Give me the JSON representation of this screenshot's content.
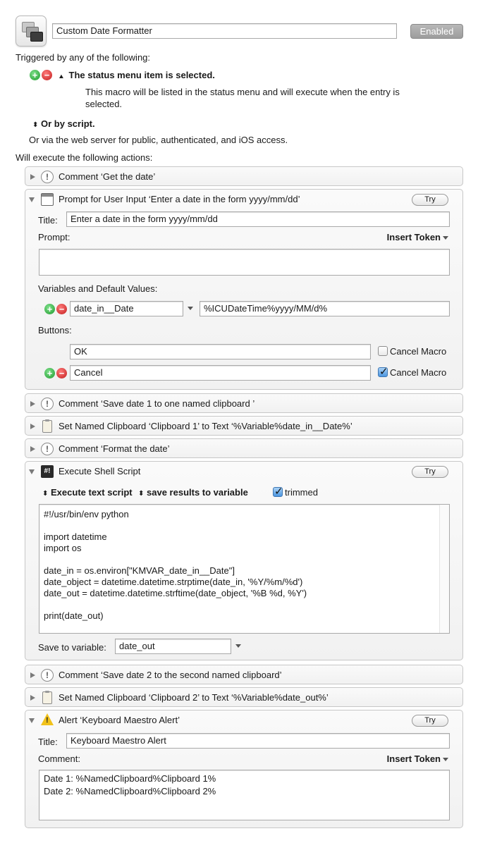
{
  "macro": {
    "name": "Custom Date Formatter",
    "enabled_label": "Enabled"
  },
  "triggers": {
    "heading": "Triggered by any of the following:",
    "status_menu_title": "The status menu item is selected.",
    "status_menu_desc_1": "This macro will be listed in the status menu and will execute when the entry is",
    "status_menu_desc_2": "selected.",
    "by_script": "Or by script.",
    "web_server": "Or via the web server for public, authenticated, and iOS access."
  },
  "actions_heading": "Will execute the following actions:",
  "common": {
    "try_label": "Try",
    "insert_token_label": "Insert Token",
    "title_label": "Title:"
  },
  "actions": {
    "comment_get_date": {
      "title": "Comment ‘Get the date’"
    },
    "prompt": {
      "title": "Prompt for User Input ‘Enter a date in the form yyyy/mm/dd’",
      "title_value": "Enter a date in the form yyyy/mm/dd",
      "prompt_label": "Prompt:",
      "prompt_value": "",
      "vars_label": "Variables and Default Values:",
      "var_name": "date_in__Date",
      "var_default": "%ICUDateTime%yyyy/MM/d%",
      "buttons_label": "Buttons:",
      "button1": "OK",
      "button1_cancel": false,
      "button2": "Cancel",
      "button2_cancel": true,
      "cancel_macro_label": "Cancel Macro"
    },
    "comment_save1": {
      "title": "Comment ‘Save date 1 to one named clipboard ’"
    },
    "set_clip1": {
      "title": "Set Named Clipboard ‘Clipboard 1’ to Text ‘%Variable%date_in__Date%’"
    },
    "comment_format": {
      "title": "Comment ‘Format the date’"
    },
    "shell": {
      "title": "Execute Shell Script",
      "mode": "Execute text script",
      "results": "save results to variable",
      "trimmed_label": "trimmed",
      "trimmed": true,
      "script_lines": [
        "#!/usr/bin/env python",
        "",
        "import datetime",
        "import os",
        "",
        "date_in = os.environ[\"KMVAR_date_in__Date\"]",
        "date_object = datetime.datetime.strptime(date_in, '%Y/%m/%d')",
        "date_out = datetime.datetime.strftime(date_object, '%B %d, %Y')",
        "",
        "print(date_out)"
      ],
      "save_to_label": "Save to variable:",
      "save_to_var": "date_out"
    },
    "comment_save2": {
      "title": "Comment ‘Save date 2 to the second named clipboard’"
    },
    "set_clip2": {
      "title": "Set Named Clipboard ‘Clipboard 2’ to Text ‘%Variable%date_out%’"
    },
    "alert": {
      "title": "Alert ‘Keyboard Maestro Alert’",
      "title_value": "Keyboard Maestro Alert",
      "comment_label": "Comment:",
      "comment_lines": [
        "Date 1: %NamedClipboard%Clipboard 1%",
        "Date 2: %NamedClipboard%Clipboard 2%"
      ]
    }
  }
}
